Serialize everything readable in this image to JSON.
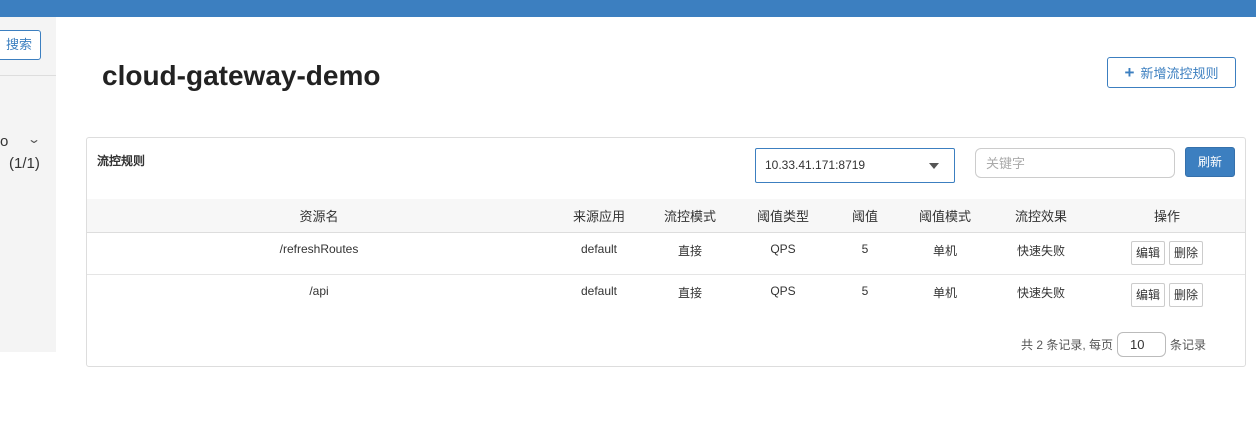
{
  "sidebar": {
    "search_button": "搜索",
    "app_name": "o",
    "app_count": "(1/1)"
  },
  "page": {
    "title": "cloud-gateway-demo",
    "add_button": "新增流控规则"
  },
  "panel": {
    "title": "流控规则",
    "machine": "10.33.41.171:8719",
    "keyword_placeholder": "关键字",
    "refresh_button": "刷新"
  },
  "table": {
    "headers": [
      "资源名",
      "来源应用",
      "流控模式",
      "阈值类型",
      "阈值",
      "阈值模式",
      "流控效果",
      "操作"
    ],
    "rows": [
      {
        "resource": "/refreshRoutes",
        "app": "default",
        "mode": "直接",
        "type": "QPS",
        "value": "5",
        "cmode": "单机",
        "effect": "快速失败"
      },
      {
        "resource": "/api",
        "app": "default",
        "mode": "直接",
        "type": "QPS",
        "value": "5",
        "cmode": "单机",
        "effect": "快速失败"
      }
    ],
    "edit_label": "编辑",
    "delete_label": "删除"
  },
  "pager": {
    "prefix": "共 2 条记录, 每页",
    "page_size": "10",
    "suffix": "条记录"
  }
}
